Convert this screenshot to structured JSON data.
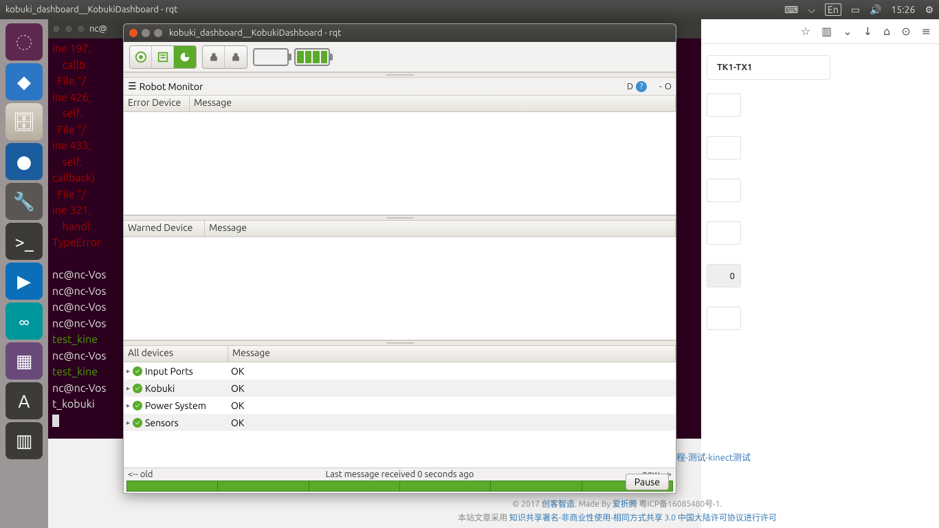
{
  "sysbar": {
    "title": "kobuki_dashboard__KobukiDashboard - rqt",
    "lang": "En",
    "time": "15:26"
  },
  "launcher": {},
  "terminal": {
    "title": "nc@",
    "text": "ine 197, \n    callb\n  File \"/\nine 426, \n    self.\n  File \"/                                                                                                       \", l\nine 433, \n    self.                                                                                                       own_\ncallback)\n  File \"/                                                                                                       \", l\nine 321, \n    handl\nTypeError\n\n",
    "prompt_lines": [
      "nc@nc-Vos",
      "nc@nc-Vos",
      "nc@nc-Vos",
      "nc@nc-Vos",
      "test_kine                                                                                                       e*",
      "nc@nc-Vos",
      "test_kine                                                                                                       s tes",
      "nc@nc-Vos",
      "t_kobuki"
    ]
  },
  "rqt": {
    "title": "kobuki_dashboard__KobukiDashboard - rqt",
    "monitor_label": "Robot Monitor",
    "right_labels": {
      "d": "D",
      "dash": "-",
      "o": "O"
    },
    "error_table": {
      "col1": "Error Device",
      "col2": "Message"
    },
    "warn_table": {
      "col1": "Warned Device",
      "col2": "Message"
    },
    "all_table": {
      "col1": "All devices",
      "col2": "Message",
      "rows": [
        {
          "name": "Input Ports",
          "msg": "OK"
        },
        {
          "name": "Kobuki",
          "msg": "OK"
        },
        {
          "name": "Power System",
          "msg": "OK"
        },
        {
          "name": "Sensors",
          "msg": "OK"
        }
      ]
    },
    "timeline": {
      "left": "<-- old",
      "mid": "Last message received 0 seconds ago",
      "right": "new -->",
      "pause": "Pause"
    }
  },
  "browser": {
    "card": "TK1-TX1",
    "badge": "0",
    "sidelink": "程-测试-kinect测试",
    "footer_line1_a": "© 2017 ",
    "footer_line1_b": "创客智造",
    "footer_line1_c": ". Made By ",
    "footer_line1_d": "爱折腾",
    "footer_line1_e": " 粤ICP备16085480号-1.",
    "footer_line2_a": "本站文章采用 ",
    "footer_line2_b": "知识共享署名-非商业性使用-相同方式共享 3.0 中国大陆许可协议进行许可"
  }
}
